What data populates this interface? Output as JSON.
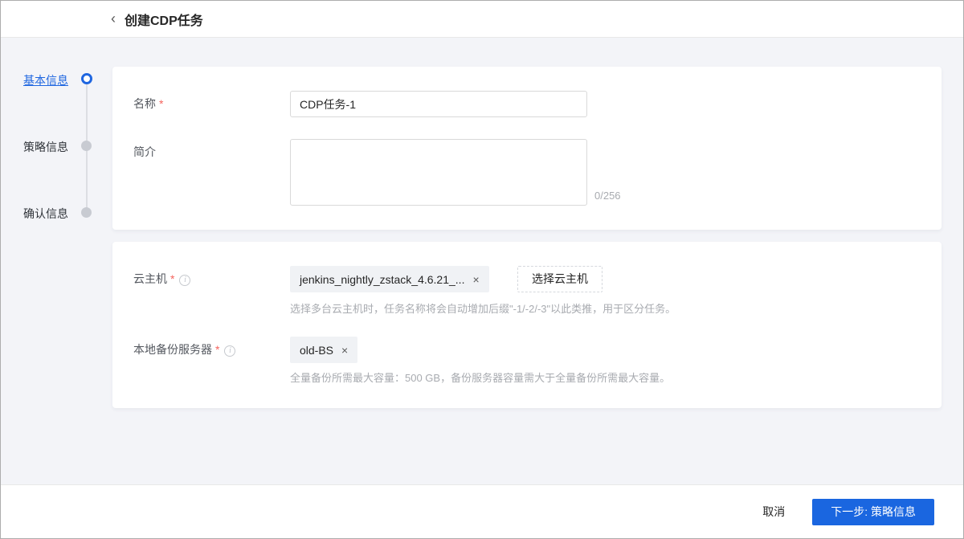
{
  "header": {
    "back_icon": "‹",
    "title": "创建CDP任务"
  },
  "steps": [
    {
      "label": "基本信息",
      "state": "active"
    },
    {
      "label": "策略信息",
      "state": "pending"
    },
    {
      "label": "确认信息",
      "state": "pending"
    }
  ],
  "basic_panel": {
    "name_label": "名称",
    "name_value": "CDP任务-1",
    "desc_label": "简介",
    "desc_value": "",
    "desc_counter": "0/256"
  },
  "resource_panel": {
    "vm_label": "云主机",
    "vm_info_icon": "i",
    "vm_tag": "jenkins_nightly_zstack_4.6.21_...",
    "vm_tag_close": "×",
    "vm_select_button": "选择云主机",
    "vm_hint": "选择多台云主机时，任务名称将会自动增加后缀\"-1/-2/-3\"以此类推，用于区分任务。",
    "bs_label": "本地备份服务器",
    "bs_info_icon": "i",
    "bs_tag": "old-BS",
    "bs_tag_close": "×",
    "bs_hint": "全量备份所需最大容量：500 GB，备份服务器容量需大于全量备份所需最大容量。"
  },
  "footer": {
    "cancel_label": "取消",
    "next_label": "下一步: 策略信息"
  },
  "required_mark": "*",
  "colors": {
    "accent": "#1a66e0",
    "background": "#f3f4f8",
    "panel": "#ffffff",
    "hint_text": "#a8abb0",
    "tag_background": "#f0f2f5",
    "required": "#f5635d"
  }
}
